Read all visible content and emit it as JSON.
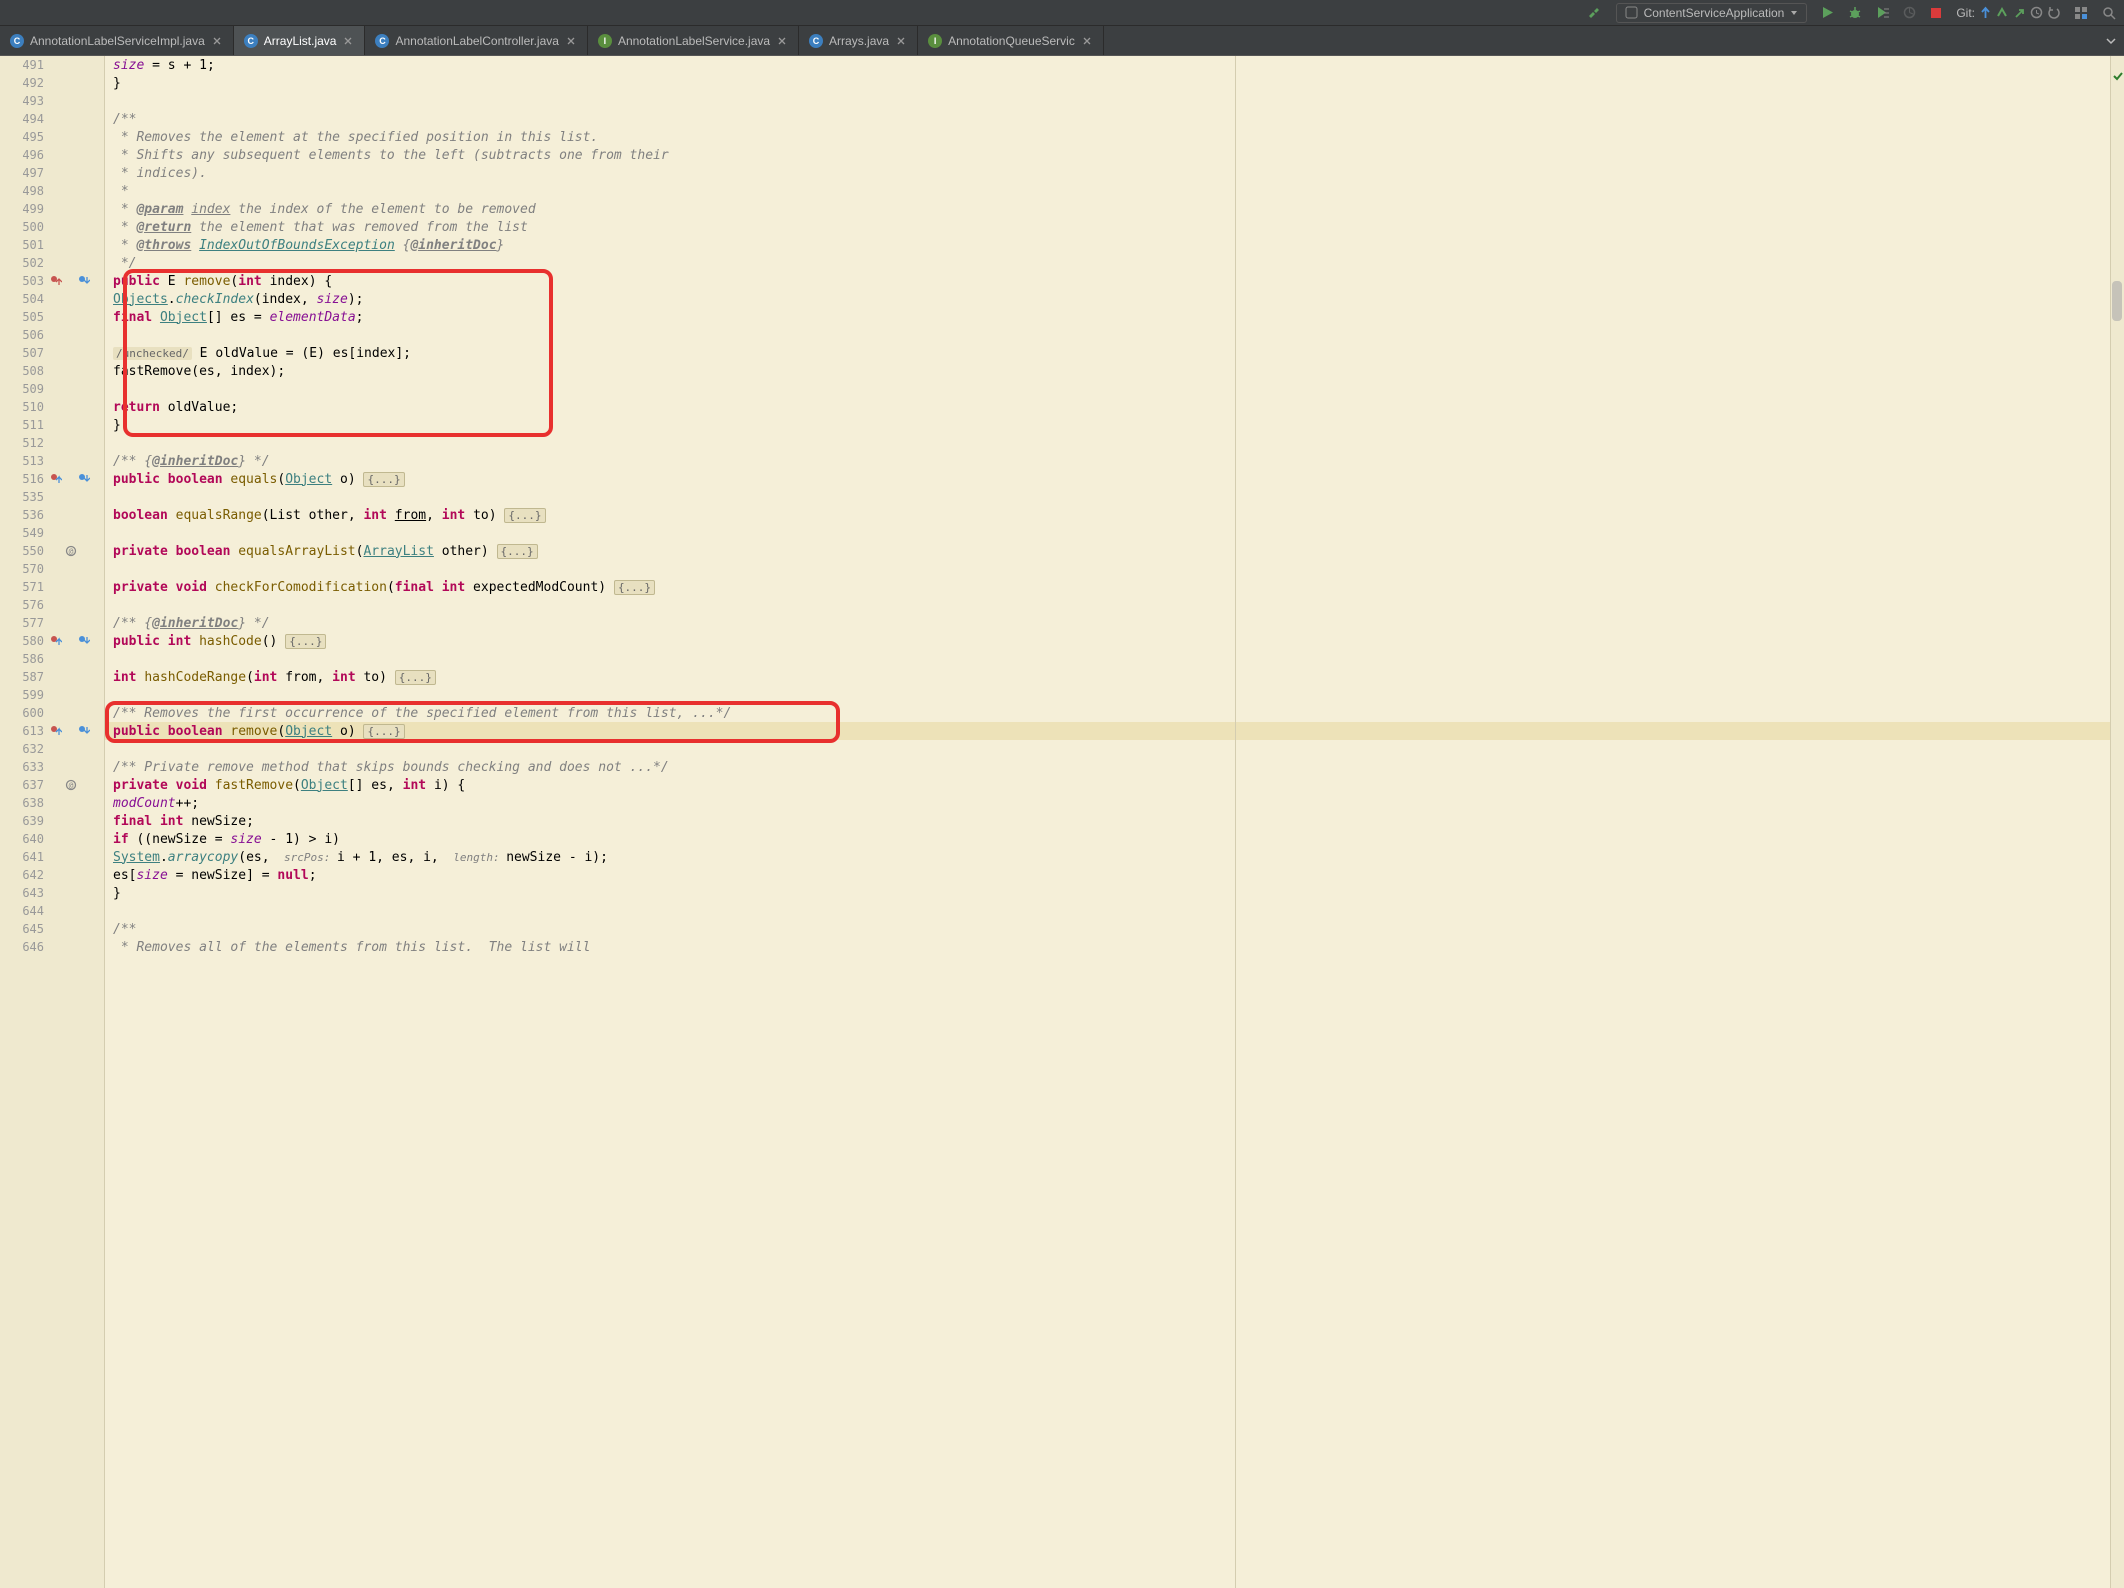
{
  "toolbar": {
    "run_config": "ContentServiceApplication",
    "git_label": "Git:"
  },
  "tabs": [
    {
      "label": "AnnotationLabelServiceImpl.java",
      "icon": "class-blue",
      "active": false
    },
    {
      "label": "ArrayList.java",
      "icon": "class-blue",
      "active": true
    },
    {
      "label": "AnnotationLabelController.java",
      "icon": "class-blue",
      "active": false
    },
    {
      "label": "AnnotationLabelService.java",
      "icon": "interface",
      "active": false
    },
    {
      "label": "Arrays.java",
      "icon": "class-blue",
      "active": false
    },
    {
      "label": "AnnotationQueueServic",
      "icon": "interface",
      "active": false
    }
  ],
  "code": {
    "lines": [
      {
        "n": "491",
        "indent": 12,
        "tokens": [
          {
            "t": "size",
            "c": "field"
          },
          {
            "t": " = s + ",
            "c": ""
          },
          {
            "t": "1",
            "c": ""
          },
          {
            "t": ";",
            "c": ""
          }
        ]
      },
      {
        "n": "492",
        "indent": 8,
        "tokens": [
          {
            "t": "}",
            "c": ""
          }
        ]
      },
      {
        "n": "493",
        "indent": 0,
        "tokens": []
      },
      {
        "n": "494",
        "indent": 8,
        "tokens": [
          {
            "t": "/**",
            "c": "comment"
          }
        ]
      },
      {
        "n": "495",
        "indent": 8,
        "tokens": [
          {
            "t": " * Removes the element at the specified position in this list.",
            "c": "comment"
          }
        ]
      },
      {
        "n": "496",
        "indent": 8,
        "tokens": [
          {
            "t": " * Shifts any subsequent elements to the left (subtracts one from their",
            "c": "comment"
          }
        ]
      },
      {
        "n": "497",
        "indent": 8,
        "tokens": [
          {
            "t": " * indices).",
            "c": "comment"
          }
        ]
      },
      {
        "n": "498",
        "indent": 8,
        "tokens": [
          {
            "t": " *",
            "c": "comment"
          }
        ]
      },
      {
        "n": "499",
        "indent": 8,
        "tokens": [
          {
            "t": " * ",
            "c": "comment"
          },
          {
            "t": "@param",
            "c": "doc-tag"
          },
          {
            "t": " ",
            "c": "comment"
          },
          {
            "t": "index",
            "c": "comment",
            "u": true
          },
          {
            "t": " the index of the element to be removed",
            "c": "comment"
          }
        ]
      },
      {
        "n": "500",
        "indent": 8,
        "tokens": [
          {
            "t": " * ",
            "c": "comment"
          },
          {
            "t": "@return",
            "c": "doc-tag"
          },
          {
            "t": " the element that was removed from the list",
            "c": "comment"
          }
        ]
      },
      {
        "n": "501",
        "indent": 8,
        "tokens": [
          {
            "t": " * ",
            "c": "comment"
          },
          {
            "t": "@throws",
            "c": "doc-tag"
          },
          {
            "t": " ",
            "c": "comment"
          },
          {
            "t": "IndexOutOfBoundsException",
            "c": "doc-link"
          },
          {
            "t": " {",
            "c": "comment"
          },
          {
            "t": "@inheritDoc",
            "c": "doc-tag"
          },
          {
            "t": "}",
            "c": "comment"
          }
        ]
      },
      {
        "n": "502",
        "indent": 8,
        "tokens": [
          {
            "t": " */",
            "c": "comment"
          }
        ]
      },
      {
        "n": "503",
        "indent": 8,
        "gutter": "override-up impl-down",
        "tokens": [
          {
            "t": "public ",
            "c": "kw"
          },
          {
            "t": "E ",
            "c": ""
          },
          {
            "t": "remove",
            "c": "method"
          },
          {
            "t": "(",
            "c": ""
          },
          {
            "t": "int ",
            "c": "kw"
          },
          {
            "t": "index) {",
            "c": ""
          }
        ]
      },
      {
        "n": "504",
        "indent": 12,
        "tokens": [
          {
            "t": "Objects",
            "c": "ref"
          },
          {
            "t": ".",
            "c": ""
          },
          {
            "t": "checkIndex",
            "c": "static-call"
          },
          {
            "t": "(index, ",
            "c": ""
          },
          {
            "t": "size",
            "c": "field"
          },
          {
            "t": ");",
            "c": ""
          }
        ]
      },
      {
        "n": "505",
        "indent": 12,
        "tokens": [
          {
            "t": "final ",
            "c": "kw"
          },
          {
            "t": "Object",
            "c": "ref"
          },
          {
            "t": "[] es = ",
            "c": ""
          },
          {
            "t": "elementData",
            "c": "field"
          },
          {
            "t": ";",
            "c": ""
          }
        ]
      },
      {
        "n": "506",
        "indent": 0,
        "tokens": []
      },
      {
        "n": "507",
        "indent": 12,
        "tokens": [
          {
            "t": "/unchecked/",
            "c": "hint-box"
          },
          {
            "t": " E oldValue = (E) es[index];",
            "c": ""
          }
        ]
      },
      {
        "n": "508",
        "indent": 12,
        "tokens": [
          {
            "t": "fastRemove(es, index);",
            "c": ""
          }
        ]
      },
      {
        "n": "509",
        "indent": 0,
        "tokens": []
      },
      {
        "n": "510",
        "indent": 12,
        "tokens": [
          {
            "t": "return ",
            "c": "kw"
          },
          {
            "t": "oldValue;",
            "c": ""
          }
        ]
      },
      {
        "n": "511",
        "indent": 8,
        "tokens": [
          {
            "t": "}",
            "c": ""
          }
        ]
      },
      {
        "n": "512",
        "indent": 0,
        "tokens": []
      },
      {
        "n": "513",
        "indent": 8,
        "tokens": [
          {
            "t": "/** {",
            "c": "comment"
          },
          {
            "t": "@inheritDoc",
            "c": "doc-tag"
          },
          {
            "t": "} */",
            "c": "comment"
          }
        ]
      },
      {
        "n": "516",
        "indent": 8,
        "gutter": "override impl-down",
        "tokens": [
          {
            "t": "public boolean ",
            "c": "kw"
          },
          {
            "t": "equals",
            "c": "method"
          },
          {
            "t": "(",
            "c": ""
          },
          {
            "t": "Object",
            "c": "ref"
          },
          {
            "t": " o) ",
            "c": ""
          },
          {
            "t": "{...}",
            "c": "fold-box"
          }
        ]
      },
      {
        "n": "535",
        "indent": 0,
        "tokens": []
      },
      {
        "n": "536",
        "indent": 8,
        "tokens": [
          {
            "t": "boolean ",
            "c": "kw"
          },
          {
            "t": "equalsRange",
            "c": "method"
          },
          {
            "t": "(List<?> other, ",
            "c": ""
          },
          {
            "t": "int ",
            "c": "kw"
          },
          {
            "t": "from",
            "c": "",
            "u": true
          },
          {
            "t": ", ",
            "c": ""
          },
          {
            "t": "int ",
            "c": "kw"
          },
          {
            "t": "to) ",
            "c": ""
          },
          {
            "t": "{...}",
            "c": "fold-box"
          }
        ]
      },
      {
        "n": "549",
        "indent": 0,
        "tokens": []
      },
      {
        "n": "550",
        "indent": 8,
        "gutter": "recursive",
        "tokens": [
          {
            "t": "private boolean ",
            "c": "kw"
          },
          {
            "t": "equalsArrayList",
            "c": "method"
          },
          {
            "t": "(",
            "c": ""
          },
          {
            "t": "ArrayList",
            "c": "ref"
          },
          {
            "t": "<?> other) ",
            "c": ""
          },
          {
            "t": "{...}",
            "c": "fold-box"
          }
        ]
      },
      {
        "n": "570",
        "indent": 0,
        "tokens": []
      },
      {
        "n": "571",
        "indent": 8,
        "tokens": [
          {
            "t": "private void ",
            "c": "kw"
          },
          {
            "t": "checkForComodification",
            "c": "method"
          },
          {
            "t": "(",
            "c": ""
          },
          {
            "t": "final int ",
            "c": "kw"
          },
          {
            "t": "expectedModCount) ",
            "c": ""
          },
          {
            "t": "{...}",
            "c": "fold-box"
          }
        ]
      },
      {
        "n": "576",
        "indent": 0,
        "tokens": []
      },
      {
        "n": "577",
        "indent": 8,
        "tokens": [
          {
            "t": "/** {",
            "c": "comment"
          },
          {
            "t": "@inheritDoc",
            "c": "doc-tag"
          },
          {
            "t": "} */",
            "c": "comment"
          }
        ]
      },
      {
        "n": "580",
        "indent": 8,
        "gutter": "override impl-down",
        "tokens": [
          {
            "t": "public int ",
            "c": "kw"
          },
          {
            "t": "hashCode",
            "c": "method"
          },
          {
            "t": "() ",
            "c": ""
          },
          {
            "t": "{...}",
            "c": "fold-box"
          }
        ]
      },
      {
        "n": "586",
        "indent": 0,
        "tokens": []
      },
      {
        "n": "587",
        "indent": 8,
        "tokens": [
          {
            "t": "int ",
            "c": "kw"
          },
          {
            "t": "hashCodeRange",
            "c": "method"
          },
          {
            "t": "(",
            "c": ""
          },
          {
            "t": "int ",
            "c": "kw"
          },
          {
            "t": "from, ",
            "c": ""
          },
          {
            "t": "int ",
            "c": "kw"
          },
          {
            "t": "to) ",
            "c": ""
          },
          {
            "t": "{...}",
            "c": "fold-box"
          }
        ]
      },
      {
        "n": "599",
        "indent": 0,
        "tokens": []
      },
      {
        "n": "600",
        "indent": 8,
        "tokens": [
          {
            "t": "/** Removes the first occurrence of the specified element from this list, ...*/",
            "c": "comment"
          }
        ]
      },
      {
        "n": "613",
        "indent": 8,
        "gutter": "override impl-down",
        "highlighted": true,
        "tokens": [
          {
            "t": "public boolean ",
            "c": "kw"
          },
          {
            "t": "remove",
            "c": "method"
          },
          {
            "t": "(",
            "c": ""
          },
          {
            "t": "Object",
            "c": "ref"
          },
          {
            "t": " o) ",
            "c": ""
          },
          {
            "t": "{...}",
            "c": "fold-box"
          }
        ]
      },
      {
        "n": "632",
        "indent": 0,
        "tokens": []
      },
      {
        "n": "633",
        "indent": 8,
        "tokens": [
          {
            "t": "/** Private remove method that skips bounds checking and does not ...*/",
            "c": "comment"
          }
        ]
      },
      {
        "n": "637",
        "indent": 8,
        "gutter": "recursive",
        "tokens": [
          {
            "t": "private void ",
            "c": "kw"
          },
          {
            "t": "fastRemove",
            "c": "method"
          },
          {
            "t": "(",
            "c": ""
          },
          {
            "t": "Object",
            "c": "ref"
          },
          {
            "t": "[] es, ",
            "c": ""
          },
          {
            "t": "int ",
            "c": "kw"
          },
          {
            "t": "i) {",
            "c": ""
          }
        ]
      },
      {
        "n": "638",
        "indent": 12,
        "tokens": [
          {
            "t": "modCount",
            "c": "field"
          },
          {
            "t": "++;",
            "c": ""
          }
        ]
      },
      {
        "n": "639",
        "indent": 12,
        "tokens": [
          {
            "t": "final int ",
            "c": "kw"
          },
          {
            "t": "newSize;",
            "c": ""
          }
        ]
      },
      {
        "n": "640",
        "indent": 12,
        "tokens": [
          {
            "t": "if ",
            "c": "kw"
          },
          {
            "t": "((newSize = ",
            "c": ""
          },
          {
            "t": "size",
            "c": "field"
          },
          {
            "t": " - ",
            "c": ""
          },
          {
            "t": "1",
            "c": ""
          },
          {
            "t": ") > i)",
            "c": ""
          }
        ]
      },
      {
        "n": "641",
        "indent": 16,
        "tokens": [
          {
            "t": "System",
            "c": "ref"
          },
          {
            "t": ".",
            "c": ""
          },
          {
            "t": "arraycopy",
            "c": "static-call"
          },
          {
            "t": "(es, ",
            "c": ""
          },
          {
            "t": " srcPos: ",
            "c": "param-name"
          },
          {
            "t": "i + ",
            "c": ""
          },
          {
            "t": "1",
            "c": ""
          },
          {
            "t": ", es, i, ",
            "c": ""
          },
          {
            "t": " length: ",
            "c": "param-name"
          },
          {
            "t": "newSize - i);",
            "c": ""
          }
        ]
      },
      {
        "n": "642",
        "indent": 12,
        "tokens": [
          {
            "t": "es[",
            "c": ""
          },
          {
            "t": "size",
            "c": "field"
          },
          {
            "t": " = newSize] = ",
            "c": ""
          },
          {
            "t": "null",
            "c": "kw"
          },
          {
            "t": ";",
            "c": ""
          }
        ]
      },
      {
        "n": "643",
        "indent": 8,
        "tokens": [
          {
            "t": "}",
            "c": ""
          }
        ]
      },
      {
        "n": "644",
        "indent": 0,
        "tokens": []
      },
      {
        "n": "645",
        "indent": 8,
        "tokens": [
          {
            "t": "/**",
            "c": "comment"
          }
        ]
      },
      {
        "n": "646",
        "indent": 8,
        "tokens": [
          {
            "t": " * Removes all of the elements from this list.  The list will",
            "c": "comment"
          }
        ]
      }
    ]
  },
  "annotations": {
    "box1": {
      "top_line": "503",
      "bottom_line": "511"
    },
    "box2": {
      "top_line": "600",
      "bottom_line": "613"
    }
  }
}
